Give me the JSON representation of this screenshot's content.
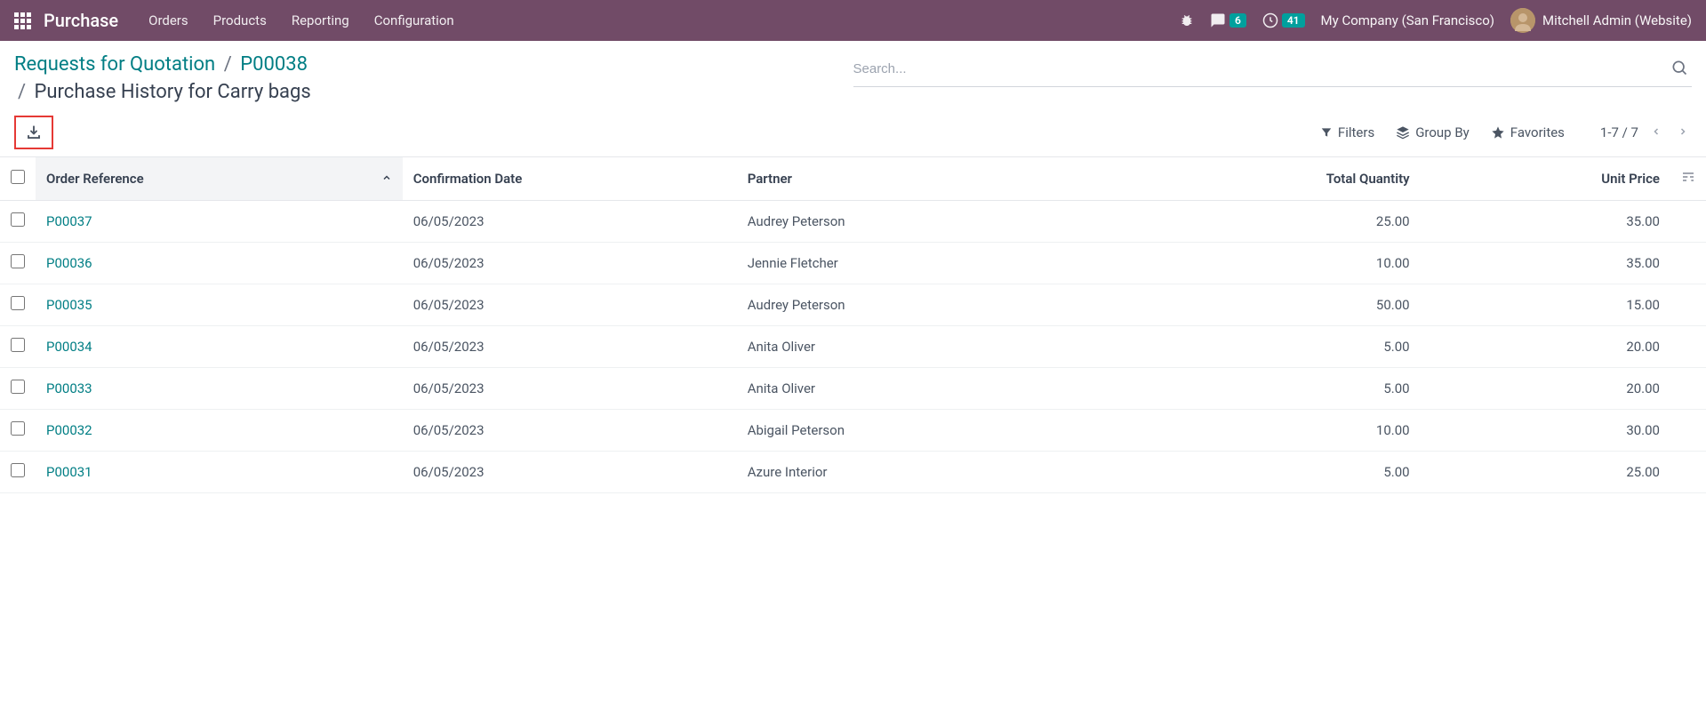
{
  "navbar": {
    "app_title": "Purchase",
    "menu": [
      "Orders",
      "Products",
      "Reporting",
      "Configuration"
    ],
    "messages_badge": "6",
    "activities_badge": "41",
    "company": "My Company (San Francisco)",
    "user": "Mitchell Admin (Website)"
  },
  "breadcrumb": {
    "root": "Requests for Quotation",
    "mid": "P00038",
    "current": "Purchase History for Carry bags"
  },
  "search": {
    "placeholder": "Search..."
  },
  "options": {
    "filters": "Filters",
    "group_by": "Group By",
    "favorites": "Favorites"
  },
  "pager": {
    "text": "1-7 / 7"
  },
  "columns": {
    "order_ref": "Order Reference",
    "confirm_date": "Confirmation Date",
    "partner": "Partner",
    "total_qty": "Total Quantity",
    "unit_price": "Unit Price"
  },
  "rows": [
    {
      "ref": "P00037",
      "date": "06/05/2023",
      "partner": "Audrey Peterson",
      "qty": "25.00",
      "price": "35.00"
    },
    {
      "ref": "P00036",
      "date": "06/05/2023",
      "partner": "Jennie Fletcher",
      "qty": "10.00",
      "price": "35.00"
    },
    {
      "ref": "P00035",
      "date": "06/05/2023",
      "partner": "Audrey Peterson",
      "qty": "50.00",
      "price": "15.00"
    },
    {
      "ref": "P00034",
      "date": "06/05/2023",
      "partner": "Anita Oliver",
      "qty": "5.00",
      "price": "20.00"
    },
    {
      "ref": "P00033",
      "date": "06/05/2023",
      "partner": "Anita Oliver",
      "qty": "5.00",
      "price": "20.00"
    },
    {
      "ref": "P00032",
      "date": "06/05/2023",
      "partner": "Abigail Peterson",
      "qty": "10.00",
      "price": "30.00"
    },
    {
      "ref": "P00031",
      "date": "06/05/2023",
      "partner": "Azure Interior",
      "qty": "5.00",
      "price": "25.00"
    }
  ]
}
